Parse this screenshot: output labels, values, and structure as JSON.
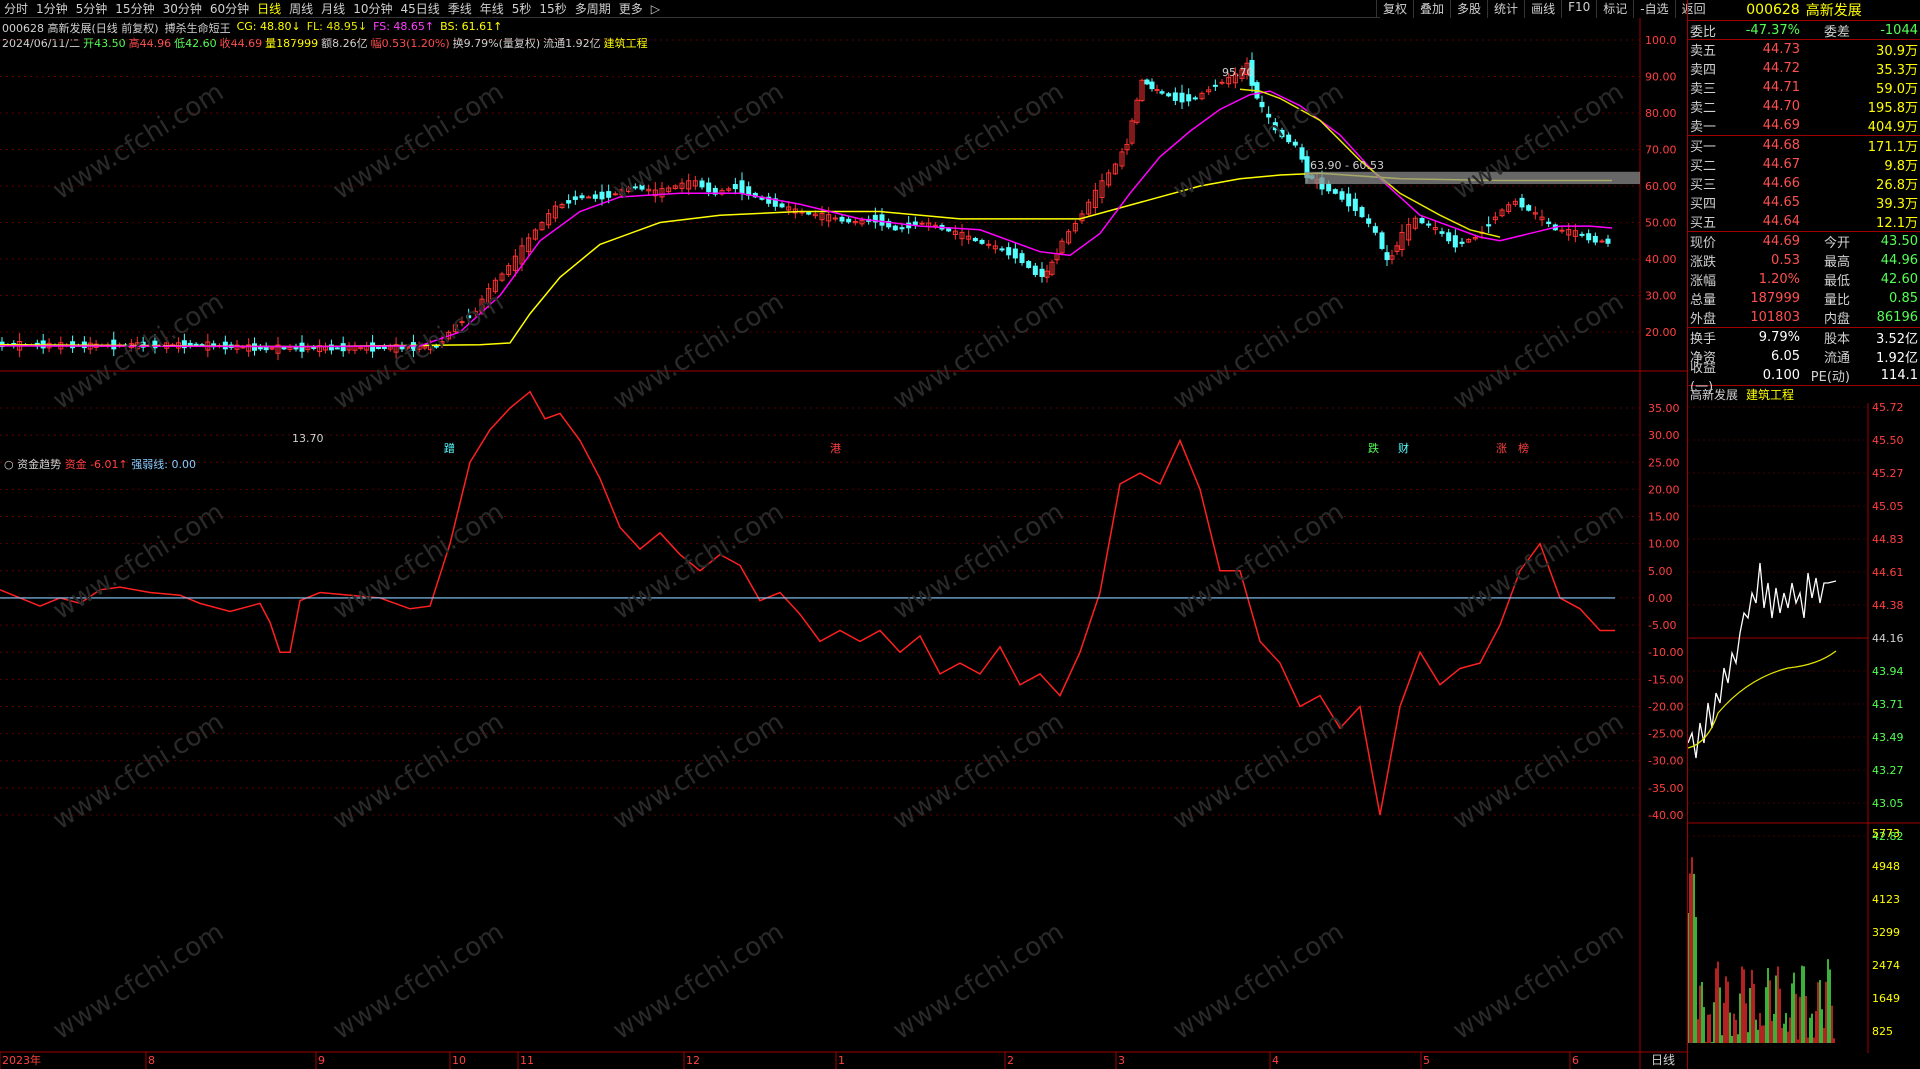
{
  "toolbar": {
    "periods": [
      "分时",
      "1分钟",
      "5分钟",
      "15分钟",
      "30分钟",
      "60分钟",
      "日线",
      "周线",
      "月线",
      "10分钟",
      "45日线",
      "季线",
      "年线",
      "5秒",
      "15秒",
      "多周期",
      "更多"
    ],
    "active": "日线",
    "more_arrow": "▷",
    "right_buttons": [
      "复权",
      "叠加",
      "多股",
      "统计",
      "画线",
      "F10",
      "标记",
      "-自选",
      "返回"
    ]
  },
  "header": {
    "stock": "000628 高新发展(日线 前复权)",
    "formula": "搏杀生命短王",
    "cg": "CG: 48.80↓",
    "fl": "FL: 48.95↓",
    "fs": "FS: 48.65↑",
    "bs": "BS: 61.61↑",
    "date": "2024/06/11/二",
    "open": "开43.50",
    "high": "高44.96",
    "low": "低42.60",
    "close": "收44.69",
    "vol": "量187999",
    "amt": "额8.26亿",
    "chg": "幅0.53(1.20%)",
    "turnover": "换9.79%(量复权)",
    "float": "流通1.92亿",
    "sector": "建筑工程"
  },
  "chart_markers": {
    "high_label": "95.70",
    "low_label": "13.70",
    "zone_label": "63.90 - 60.53",
    "events": [
      "蹭",
      "港",
      "跌",
      "财",
      "涨",
      "榜"
    ]
  },
  "price_axis": [
    "100.0",
    "90.00",
    "80.00",
    "70.00",
    "60.00",
    "50.00",
    "40.00",
    "30.00",
    "20.00"
  ],
  "indicator": {
    "name": "资金趋势",
    "fund_label": "资金",
    "fund_value": "-6.01↑",
    "line_label": "强弱线:",
    "line_value": "0.00"
  },
  "indicator_axis": [
    "35.00",
    "30.00",
    "25.00",
    "20.00",
    "15.00",
    "10.00",
    "5.00",
    "0.00",
    "-5.00",
    "-10.00",
    "-15.00",
    "-20.00",
    "-25.00",
    "-30.00",
    "-35.00",
    "-40.00"
  ],
  "time_axis": [
    "2023年",
    "8",
    "9",
    "10",
    "11",
    "12",
    "1",
    "2",
    "3",
    "4",
    "5",
    "6"
  ],
  "period_tag": "日线",
  "colors": {
    "up": "#ff3232",
    "down": "#54ffff",
    "ma_yellow": "#ffff00",
    "ma_magenta": "#ff00ff",
    "ma_gold": "#e6e600",
    "fund_line": "#ff2020",
    "zero_line": "#88ccff"
  },
  "quote": {
    "code": "000628",
    "name": "高新发展",
    "weibi": {
      "l1": "委比",
      "v1": "-47.37%",
      "l2": "委差",
      "v2": "-1044"
    },
    "sells": [
      {
        "l": "卖五",
        "p": "44.73",
        "v": "30.9万"
      },
      {
        "l": "卖四",
        "p": "44.72",
        "v": "35.3万"
      },
      {
        "l": "卖三",
        "p": "44.71",
        "v": "59.0万"
      },
      {
        "l": "卖二",
        "p": "44.70",
        "v": "195.8万"
      },
      {
        "l": "卖一",
        "p": "44.69",
        "v": "404.9万"
      }
    ],
    "buys": [
      {
        "l": "买一",
        "p": "44.68",
        "v": "171.1万"
      },
      {
        "l": "买二",
        "p": "44.67",
        "v": "9.8万"
      },
      {
        "l": "买三",
        "p": "44.66",
        "v": "26.8万"
      },
      {
        "l": "买四",
        "p": "44.65",
        "v": "39.3万"
      },
      {
        "l": "买五",
        "p": "44.64",
        "v": "12.1万"
      }
    ],
    "stats": [
      {
        "l1": "现价",
        "v1": "44.69",
        "l2": "今开",
        "v2": "43.50"
      },
      {
        "l1": "涨跌",
        "v1": "0.53",
        "l2": "最高",
        "v2": "44.96"
      },
      {
        "l1": "涨幅",
        "v1": "1.20%",
        "l2": "最低",
        "v2": "42.60"
      },
      {
        "l1": "总量",
        "v1": "187999",
        "l2": "量比",
        "v2": "0.85"
      },
      {
        "l1": "外盘",
        "v1": "101803",
        "l2": "内盘",
        "v2": "86196"
      }
    ],
    "stats2": [
      {
        "l1": "换手",
        "v1": "9.79%",
        "l2": "股本",
        "v2": "3.52亿"
      },
      {
        "l1": "净资",
        "v1": "6.05",
        "l2": "流通",
        "v2": "1.92亿"
      },
      {
        "l1": "收益(一)",
        "v1": "0.100",
        "l2": "PE(动)",
        "v2": "114.1"
      }
    ],
    "mini_title": "高新发展",
    "mini_sector": "建筑工程",
    "mini_axis": [
      "45.72",
      "45.50",
      "45.27",
      "45.05",
      "44.83",
      "44.61",
      "44.38",
      "44.16",
      "43.94",
      "43.71",
      "43.49",
      "43.27",
      "43.05",
      "42.82"
    ],
    "vol_axis": [
      "5773",
      "4948",
      "4123",
      "3299",
      "2474",
      "1649",
      "825"
    ]
  }
}
